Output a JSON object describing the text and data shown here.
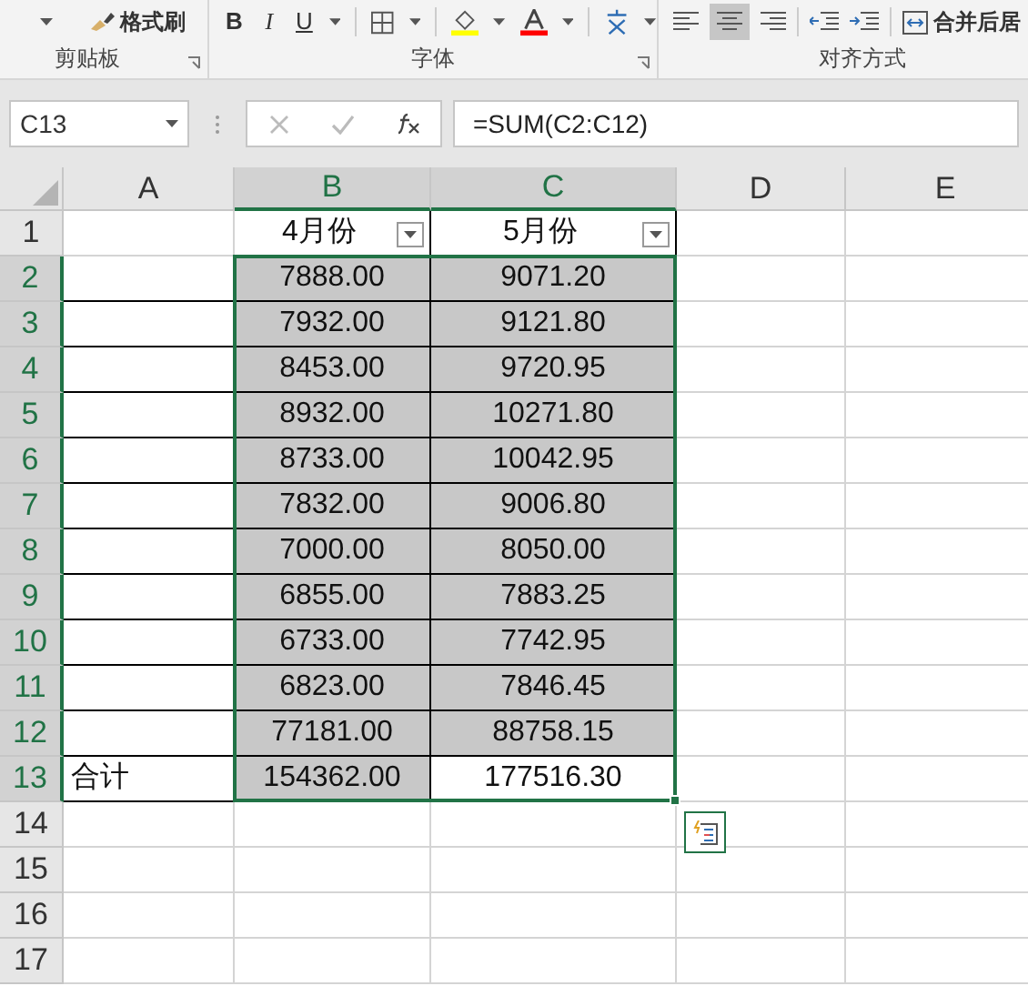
{
  "ribbon": {
    "clipboard": {
      "format_painter": "格式刷",
      "label": "剪贴板"
    },
    "font": {
      "bold": "B",
      "italic": "I",
      "underline": "U",
      "label": "字体"
    },
    "alignment": {
      "merge": "合并后居",
      "label": "对齐方式"
    }
  },
  "formula_bar": {
    "name_box": "C13",
    "formula": "=SUM(C2:C12)"
  },
  "columns": [
    {
      "label": "A",
      "selected": false
    },
    {
      "label": "B",
      "selected": true
    },
    {
      "label": "C",
      "selected": true
    },
    {
      "label": "D",
      "selected": false
    },
    {
      "label": "E",
      "selected": false
    }
  ],
  "rows": [
    {
      "header": "1",
      "selected": false,
      "cells": [
        {},
        {
          "text": "4月份",
          "bordered": true,
          "filter": true
        },
        {
          "text": "5月份",
          "bordered": true,
          "filter": true
        }
      ]
    },
    {
      "header": "2",
      "selected": true,
      "cells": [
        {
          "bordered": true
        },
        {
          "text": "7888.00",
          "bordered": true,
          "shaded": true
        },
        {
          "text": "9071.20",
          "bordered": true,
          "shaded": true
        }
      ]
    },
    {
      "header": "3",
      "selected": true,
      "cells": [
        {
          "bordered": true
        },
        {
          "text": "7932.00",
          "bordered": true,
          "shaded": true
        },
        {
          "text": "9121.80",
          "bordered": true,
          "shaded": true
        }
      ]
    },
    {
      "header": "4",
      "selected": true,
      "cells": [
        {
          "bordered": true
        },
        {
          "text": "8453.00",
          "bordered": true,
          "shaded": true
        },
        {
          "text": "9720.95",
          "bordered": true,
          "shaded": true
        }
      ]
    },
    {
      "header": "5",
      "selected": true,
      "cells": [
        {
          "bordered": true
        },
        {
          "text": "8932.00",
          "bordered": true,
          "shaded": true
        },
        {
          "text": "10271.80",
          "bordered": true,
          "shaded": true
        }
      ]
    },
    {
      "header": "6",
      "selected": true,
      "cells": [
        {
          "bordered": true
        },
        {
          "text": "8733.00",
          "bordered": true,
          "shaded": true
        },
        {
          "text": "10042.95",
          "bordered": true,
          "shaded": true
        }
      ]
    },
    {
      "header": "7",
      "selected": true,
      "cells": [
        {
          "bordered": true
        },
        {
          "text": "7832.00",
          "bordered": true,
          "shaded": true
        },
        {
          "text": "9006.80",
          "bordered": true,
          "shaded": true
        }
      ]
    },
    {
      "header": "8",
      "selected": true,
      "cells": [
        {
          "bordered": true
        },
        {
          "text": "7000.00",
          "bordered": true,
          "shaded": true
        },
        {
          "text": "8050.00",
          "bordered": true,
          "shaded": true
        }
      ]
    },
    {
      "header": "9",
      "selected": true,
      "cells": [
        {
          "bordered": true
        },
        {
          "text": "6855.00",
          "bordered": true,
          "shaded": true
        },
        {
          "text": "7883.25",
          "bordered": true,
          "shaded": true
        }
      ]
    },
    {
      "header": "10",
      "selected": true,
      "cells": [
        {
          "bordered": true
        },
        {
          "text": "6733.00",
          "bordered": true,
          "shaded": true
        },
        {
          "text": "7742.95",
          "bordered": true,
          "shaded": true
        }
      ]
    },
    {
      "header": "11",
      "selected": true,
      "cells": [
        {
          "bordered": true
        },
        {
          "text": "6823.00",
          "bordered": true,
          "shaded": true
        },
        {
          "text": "7846.45",
          "bordered": true,
          "shaded": true
        }
      ]
    },
    {
      "header": "12",
      "selected": true,
      "cells": [
        {
          "bordered": true
        },
        {
          "text": "77181.00",
          "bordered": true,
          "shaded": true
        },
        {
          "text": "88758.15",
          "bordered": true,
          "shaded": true
        }
      ]
    },
    {
      "header": "13",
      "selected": true,
      "cells": [
        {
          "text": "合计",
          "bordered": true
        },
        {
          "text": "154362.00",
          "bordered": true,
          "shaded": true
        },
        {
          "text": "177516.30",
          "bordered": true,
          "shaded": false
        }
      ]
    },
    {
      "header": "14",
      "selected": false
    },
    {
      "header": "15",
      "selected": false
    },
    {
      "header": "16",
      "selected": false
    },
    {
      "header": "17",
      "selected": false
    }
  ]
}
